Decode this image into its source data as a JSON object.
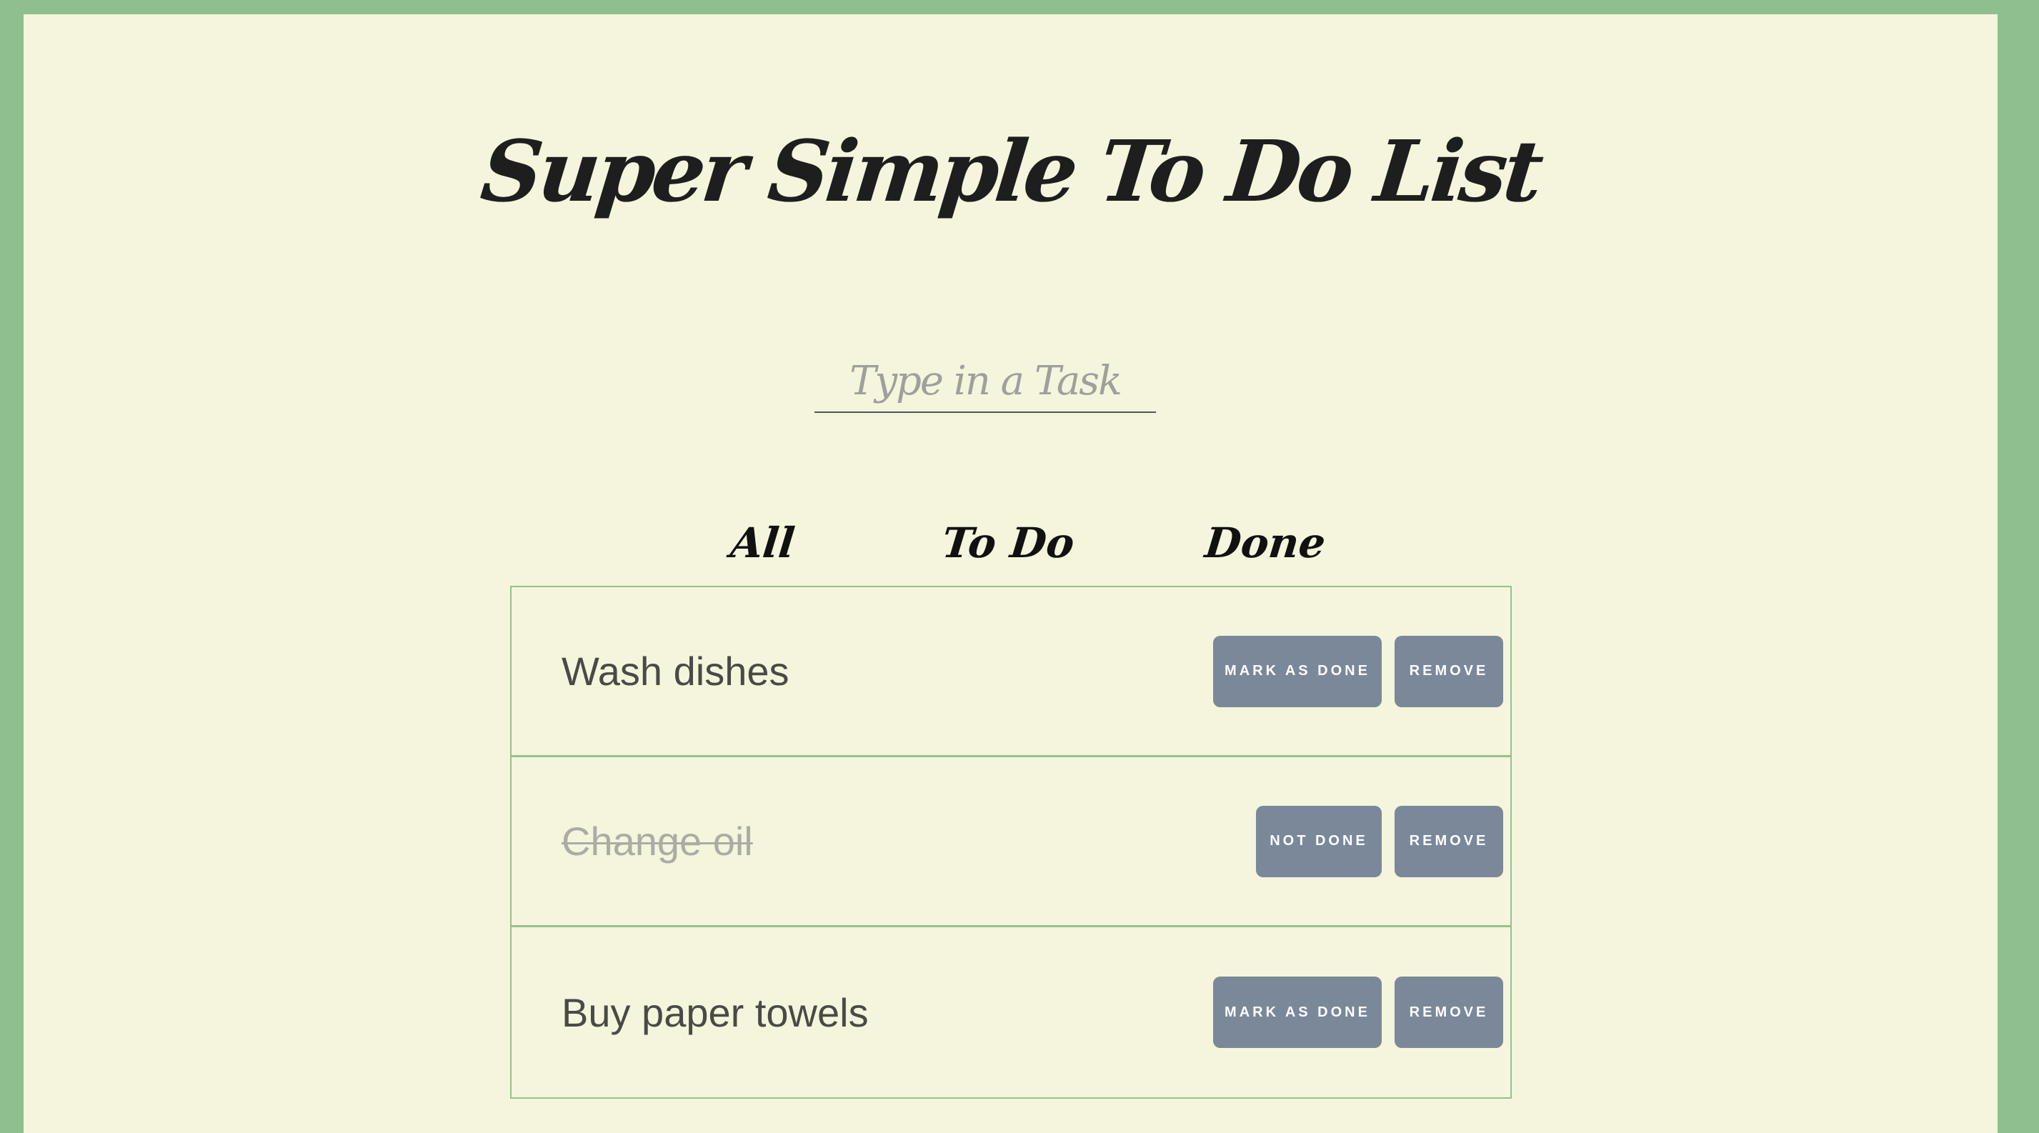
{
  "app": {
    "title": "Super Simple To Do List"
  },
  "input": {
    "placeholder": "Type in a Task",
    "value": ""
  },
  "filters": {
    "all": "All",
    "todo": "To Do",
    "done": "Done"
  },
  "tasks": [
    {
      "text": "Wash dishes",
      "done": false,
      "toggle_label": "MARK AS DONE",
      "remove_label": "REMOVE"
    },
    {
      "text": "Change oil",
      "done": true,
      "toggle_label": "NOT DONE",
      "remove_label": "REMOVE"
    },
    {
      "text": "Buy paper towels",
      "done": false,
      "toggle_label": "MARK AS DONE",
      "remove_label": "REMOVE"
    }
  ],
  "colors": {
    "outer_background": "#8fbf8e",
    "page_background": "#f4f5dc",
    "button": "#7a8899",
    "row_border": "#96c08f"
  }
}
